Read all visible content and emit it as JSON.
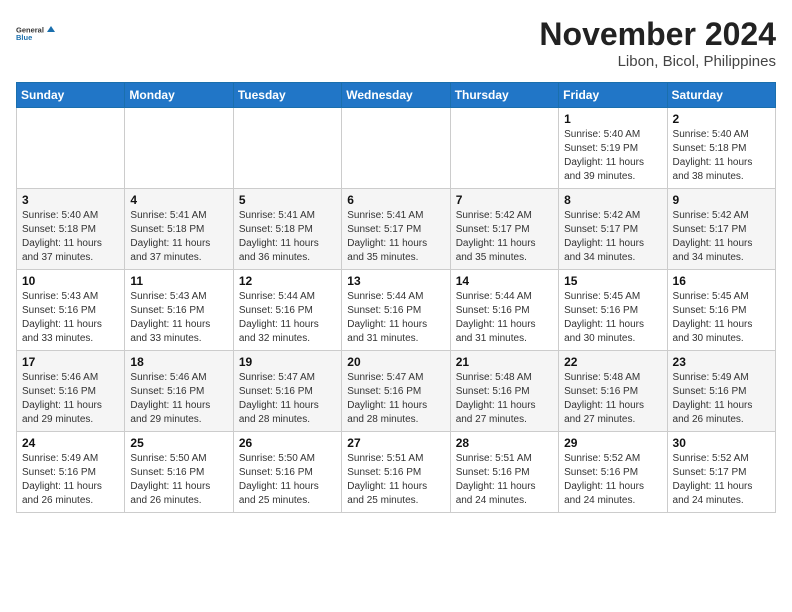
{
  "header": {
    "logo_line1": "General",
    "logo_line2": "Blue",
    "title": "November 2024",
    "subtitle": "Libon, Bicol, Philippines"
  },
  "calendar": {
    "days_of_week": [
      "Sunday",
      "Monday",
      "Tuesday",
      "Wednesday",
      "Thursday",
      "Friday",
      "Saturday"
    ],
    "weeks": [
      [
        {
          "day": "",
          "info": ""
        },
        {
          "day": "",
          "info": ""
        },
        {
          "day": "",
          "info": ""
        },
        {
          "day": "",
          "info": ""
        },
        {
          "day": "",
          "info": ""
        },
        {
          "day": "1",
          "info": "Sunrise: 5:40 AM\nSunset: 5:19 PM\nDaylight: 11 hours and 39 minutes."
        },
        {
          "day": "2",
          "info": "Sunrise: 5:40 AM\nSunset: 5:18 PM\nDaylight: 11 hours and 38 minutes."
        }
      ],
      [
        {
          "day": "3",
          "info": "Sunrise: 5:40 AM\nSunset: 5:18 PM\nDaylight: 11 hours and 37 minutes."
        },
        {
          "day": "4",
          "info": "Sunrise: 5:41 AM\nSunset: 5:18 PM\nDaylight: 11 hours and 37 minutes."
        },
        {
          "day": "5",
          "info": "Sunrise: 5:41 AM\nSunset: 5:18 PM\nDaylight: 11 hours and 36 minutes."
        },
        {
          "day": "6",
          "info": "Sunrise: 5:41 AM\nSunset: 5:17 PM\nDaylight: 11 hours and 35 minutes."
        },
        {
          "day": "7",
          "info": "Sunrise: 5:42 AM\nSunset: 5:17 PM\nDaylight: 11 hours and 35 minutes."
        },
        {
          "day": "8",
          "info": "Sunrise: 5:42 AM\nSunset: 5:17 PM\nDaylight: 11 hours and 34 minutes."
        },
        {
          "day": "9",
          "info": "Sunrise: 5:42 AM\nSunset: 5:17 PM\nDaylight: 11 hours and 34 minutes."
        }
      ],
      [
        {
          "day": "10",
          "info": "Sunrise: 5:43 AM\nSunset: 5:16 PM\nDaylight: 11 hours and 33 minutes."
        },
        {
          "day": "11",
          "info": "Sunrise: 5:43 AM\nSunset: 5:16 PM\nDaylight: 11 hours and 33 minutes."
        },
        {
          "day": "12",
          "info": "Sunrise: 5:44 AM\nSunset: 5:16 PM\nDaylight: 11 hours and 32 minutes."
        },
        {
          "day": "13",
          "info": "Sunrise: 5:44 AM\nSunset: 5:16 PM\nDaylight: 11 hours and 31 minutes."
        },
        {
          "day": "14",
          "info": "Sunrise: 5:44 AM\nSunset: 5:16 PM\nDaylight: 11 hours and 31 minutes."
        },
        {
          "day": "15",
          "info": "Sunrise: 5:45 AM\nSunset: 5:16 PM\nDaylight: 11 hours and 30 minutes."
        },
        {
          "day": "16",
          "info": "Sunrise: 5:45 AM\nSunset: 5:16 PM\nDaylight: 11 hours and 30 minutes."
        }
      ],
      [
        {
          "day": "17",
          "info": "Sunrise: 5:46 AM\nSunset: 5:16 PM\nDaylight: 11 hours and 29 minutes."
        },
        {
          "day": "18",
          "info": "Sunrise: 5:46 AM\nSunset: 5:16 PM\nDaylight: 11 hours and 29 minutes."
        },
        {
          "day": "19",
          "info": "Sunrise: 5:47 AM\nSunset: 5:16 PM\nDaylight: 11 hours and 28 minutes."
        },
        {
          "day": "20",
          "info": "Sunrise: 5:47 AM\nSunset: 5:16 PM\nDaylight: 11 hours and 28 minutes."
        },
        {
          "day": "21",
          "info": "Sunrise: 5:48 AM\nSunset: 5:16 PM\nDaylight: 11 hours and 27 minutes."
        },
        {
          "day": "22",
          "info": "Sunrise: 5:48 AM\nSunset: 5:16 PM\nDaylight: 11 hours and 27 minutes."
        },
        {
          "day": "23",
          "info": "Sunrise: 5:49 AM\nSunset: 5:16 PM\nDaylight: 11 hours and 26 minutes."
        }
      ],
      [
        {
          "day": "24",
          "info": "Sunrise: 5:49 AM\nSunset: 5:16 PM\nDaylight: 11 hours and 26 minutes."
        },
        {
          "day": "25",
          "info": "Sunrise: 5:50 AM\nSunset: 5:16 PM\nDaylight: 11 hours and 26 minutes."
        },
        {
          "day": "26",
          "info": "Sunrise: 5:50 AM\nSunset: 5:16 PM\nDaylight: 11 hours and 25 minutes."
        },
        {
          "day": "27",
          "info": "Sunrise: 5:51 AM\nSunset: 5:16 PM\nDaylight: 11 hours and 25 minutes."
        },
        {
          "day": "28",
          "info": "Sunrise: 5:51 AM\nSunset: 5:16 PM\nDaylight: 11 hours and 24 minutes."
        },
        {
          "day": "29",
          "info": "Sunrise: 5:52 AM\nSunset: 5:16 PM\nDaylight: 11 hours and 24 minutes."
        },
        {
          "day": "30",
          "info": "Sunrise: 5:52 AM\nSunset: 5:17 PM\nDaylight: 11 hours and 24 minutes."
        }
      ]
    ]
  }
}
